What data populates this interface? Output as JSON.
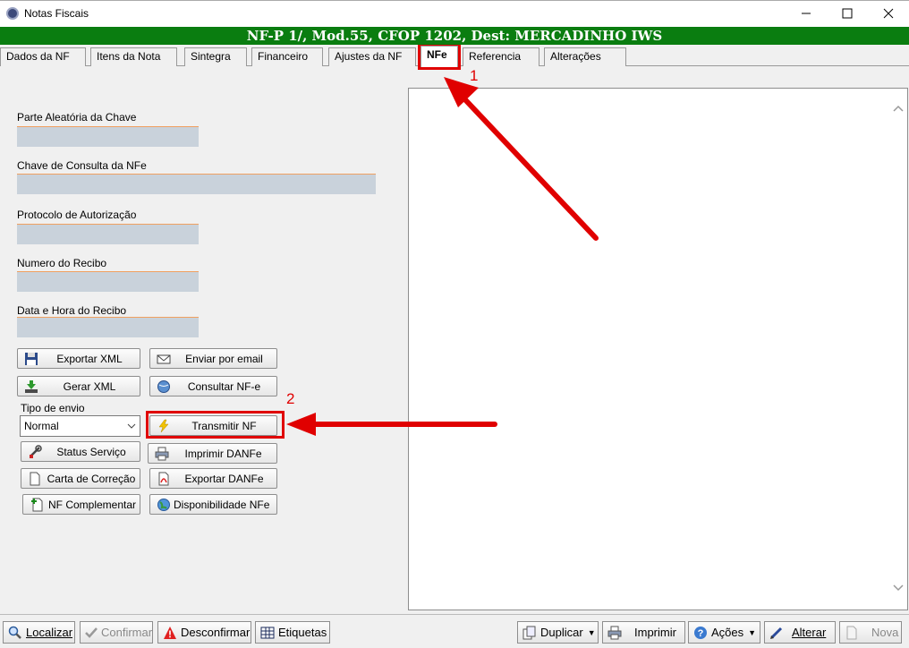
{
  "window": {
    "title": "Notas Fiscais"
  },
  "banner": {
    "text": "NF-P 1/, Mod.55, CFOP 1202, Dest: MERCADINHO IWS"
  },
  "tabs": [
    {
      "label": "Dados da NF"
    },
    {
      "label": "Itens da Nota"
    },
    {
      "label": "Sintegra"
    },
    {
      "label": "Financeiro"
    },
    {
      "label": "Ajustes da NF"
    },
    {
      "label": "NFe"
    },
    {
      "label": "Referencia"
    },
    {
      "label": "Alterações"
    }
  ],
  "fields": {
    "parte_aleatoria": {
      "label": "Parte Aleatória da Chave",
      "value": ""
    },
    "chave_consulta": {
      "label": "Chave de Consulta da NFe",
      "value": ""
    },
    "protocolo": {
      "label": "Protocolo de Autorização",
      "value": ""
    },
    "numero_recibo": {
      "label": "Numero do Recibo",
      "value": ""
    },
    "data_hora_recibo": {
      "label": "Data e Hora do Recibo",
      "value": ""
    }
  },
  "tipo_envio": {
    "label": "Tipo de envio",
    "selected": "Normal"
  },
  "buttons": {
    "exportar_xml": "Exportar XML",
    "enviar_email": "Enviar por email",
    "gerar_xml": "Gerar XML",
    "consultar_nfe": "Consultar NF-e",
    "transmitir_nf": "Transmitir NF",
    "status_servico": "Status Serviço",
    "imprimir_danfe": "Imprimir DANFe",
    "carta_correcao": "Carta de Correção",
    "exportar_danfe": "Exportar DANFe",
    "nf_complementar": "NF Complementar",
    "disponibilidade": "Disponibilidade NFe"
  },
  "footer": {
    "localizar": "Localizar",
    "confirmar": "Confirmar",
    "desconfirmar": "Desconfirmar",
    "etiquetas": "Etiquetas",
    "duplicar": "Duplicar",
    "imprimir": "Imprimir",
    "acoes": "Ações",
    "alterar": "Alterar",
    "nova": "Nova"
  },
  "annotations": {
    "step1": "1",
    "step2": "2",
    "color": "#e00000"
  },
  "colors": {
    "banner": "#0a7d10",
    "field_fill": "#c9d2db",
    "field_underline": "#f0a060"
  }
}
